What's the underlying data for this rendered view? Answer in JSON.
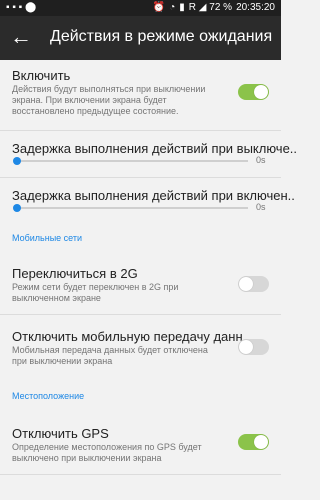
{
  "status": {
    "battery_text": "R ◢ 72 %",
    "time": "20:35:20"
  },
  "toolbar": {
    "title": "Действия в режиме ожидания"
  },
  "items": [
    {
      "title": "Включить",
      "summary": "Действия будут выполняться при выключении экрана. При включении экрана будет восстановлено предыдущее состояние.",
      "toggle": "on"
    },
    {
      "title": "Задержка выполнения действий при выключе..",
      "value": "0s"
    },
    {
      "title": "Задержка выполнения действий при включен..",
      "value": "0s"
    }
  ],
  "sections": {
    "mobile": "Мобильные сети",
    "location": "Местоположение"
  },
  "mobile_items": [
    {
      "title": "Переключиться в 2G",
      "summary": "Режим сети будет переключен в 2G при выключенном экране",
      "toggle": "off"
    },
    {
      "title": "Отключить мобильную передачу данн..",
      "summary": "Мобильная передача данных будет отключена при выключении экрана",
      "toggle": "off"
    }
  ],
  "location_items": [
    {
      "title": "Отключить GPS",
      "summary": "Определение местоположения по GPS будет выключено при выключении экрана",
      "toggle": "on"
    }
  ],
  "colors": {
    "accent": "#1e88e5",
    "toggle_on": "#8bc34a"
  }
}
